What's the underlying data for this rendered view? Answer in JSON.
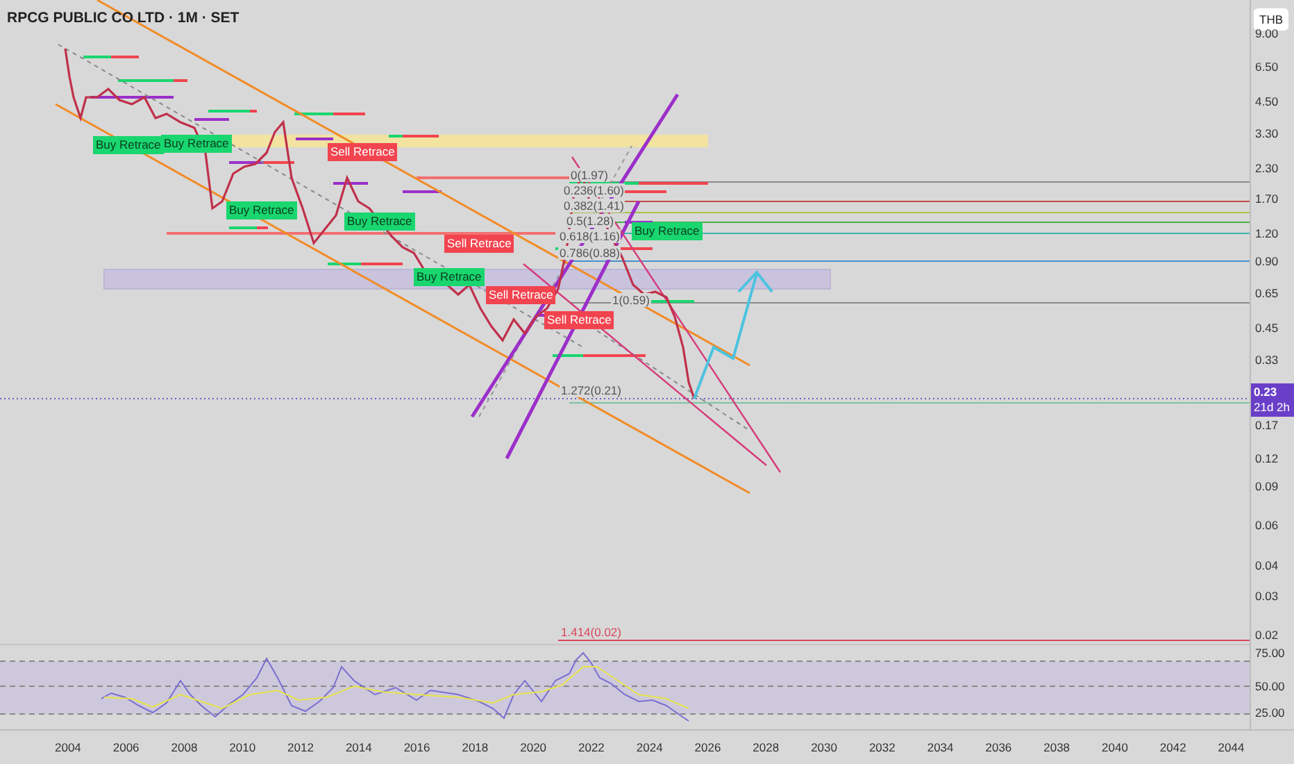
{
  "title": "RPCG PUBLIC CO LTD · 1M · SET",
  "currency": "THB",
  "annotations": [
    {
      "kind": "buy",
      "text": "Buy Retrace"
    },
    {
      "kind": "buy",
      "text": "Buy Retrace"
    },
    {
      "kind": "sell",
      "text": "Sell Retrace"
    },
    {
      "kind": "buy",
      "text": "Buy Retrace"
    },
    {
      "kind": "buy",
      "text": "Buy Retrace"
    },
    {
      "kind": "sell",
      "text": "Sell Retrace"
    },
    {
      "kind": "buy",
      "text": "Buy Retrace"
    },
    {
      "kind": "sell",
      "text": "Sell Retrace"
    },
    {
      "kind": "sell",
      "text": "Sell Retrace"
    },
    {
      "kind": "buy",
      "text": "Buy Retrace"
    }
  ],
  "fib_labels": [
    "0(1.97)",
    "0.236(1.60)",
    "0.382(1.41)",
    "0.5(1.28)",
    "0.618(1.16)",
    "0.786(0.88)",
    "1(0.59)",
    "1.272(0.21)",
    "1.414(0.02)"
  ],
  "price_axis": [
    "9.00",
    "6.50",
    "4.50",
    "3.30",
    "2.30",
    "1.70",
    "1.20",
    "0.90",
    "0.65",
    "0.45",
    "0.33",
    "0.17",
    "0.12",
    "0.09",
    "0.06",
    "0.04",
    "0.03",
    "0.02"
  ],
  "price_tag": {
    "price": "0.23",
    "countdown": "21d 2h"
  },
  "rsi_axis": [
    "75.00",
    "50.00",
    "25.00"
  ],
  "time_axis": [
    "2004",
    "2006",
    "2008",
    "2010",
    "2012",
    "2014",
    "2016",
    "2018",
    "2020",
    "2022",
    "2024",
    "2026",
    "2028",
    "2030",
    "2032",
    "2034",
    "2036",
    "2038",
    "2040",
    "2042",
    "2044"
  ]
}
